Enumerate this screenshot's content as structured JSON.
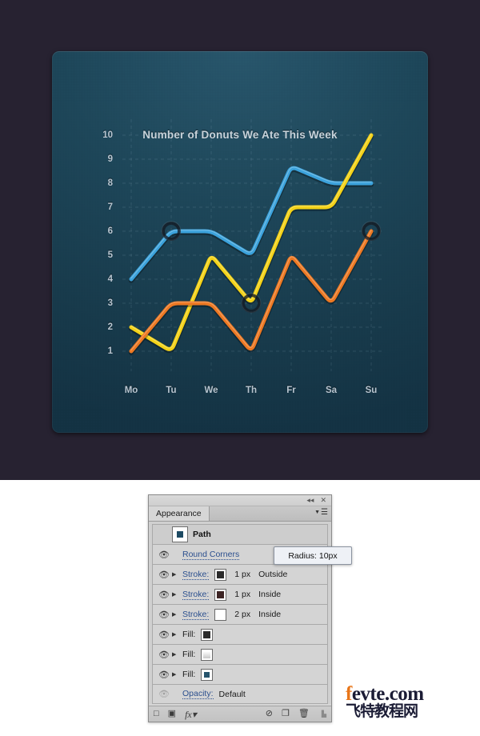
{
  "chart_data": {
    "type": "line",
    "title": "Number of Donuts We Ate This Week",
    "xlabel": "",
    "ylabel": "",
    "categories": [
      "Mo",
      "Tu",
      "We",
      "Th",
      "Fr",
      "Sa",
      "Su"
    ],
    "ylim": [
      1,
      10
    ],
    "yticks": [
      1,
      2,
      3,
      4,
      5,
      6,
      7,
      8,
      9,
      10
    ],
    "grid": true,
    "legend": "none",
    "series": [
      {
        "name": "blue",
        "color": "#3ba3dd",
        "values": [
          4,
          6,
          6,
          5,
          8.7,
          8,
          8
        ]
      },
      {
        "name": "yellow",
        "color": "#f5d316",
        "values": [
          2,
          1,
          5,
          3,
          7,
          7,
          10
        ]
      },
      {
        "name": "orange",
        "color": "#ee7821",
        "values": [
          1,
          3,
          3,
          1,
          5,
          3,
          6
        ]
      }
    ],
    "markers": [
      {
        "series": "blue",
        "category": "Tu",
        "value": 6
      },
      {
        "series": "yellow",
        "category": "Th",
        "value": 3
      },
      {
        "series": "orange",
        "category": "Su",
        "value": 6
      }
    ]
  },
  "panel": {
    "titlebar": {
      "collapse_icon": "collapse-double-arrow-icon",
      "close_icon": "close-icon"
    },
    "tab_label": "Appearance",
    "menu_icon": "panel-menu-icon",
    "rows": [
      {
        "type": "header",
        "label": "Path",
        "eye": false,
        "swatch": "#1d4a63"
      },
      {
        "type": "effect",
        "label": "Round Corners",
        "eye": true,
        "eye_dim": false,
        "disclosure": false
      },
      {
        "type": "stroke",
        "label": "Stroke:",
        "eye": true,
        "disclosure": true,
        "color": "#2b2b2b",
        "width": "1 px",
        "align": "Outside"
      },
      {
        "type": "stroke",
        "label": "Stroke:",
        "eye": true,
        "disclosure": true,
        "color": "#3d2424",
        "width": "1 px",
        "align": "Inside"
      },
      {
        "type": "stroke",
        "label": "Stroke:",
        "eye": true,
        "disclosure": true,
        "color": "#ffffff",
        "width": "2 px",
        "align": "Inside"
      },
      {
        "type": "fill",
        "label": "Fill:",
        "eye": true,
        "disclosure": true,
        "color": "#2b2b2b"
      },
      {
        "type": "fill",
        "label": "Fill:",
        "eye": true,
        "disclosure": true,
        "color": "gradient-white"
      },
      {
        "type": "fill",
        "label": "Fill:",
        "eye": true,
        "disclosure": true,
        "color": "#26546c"
      },
      {
        "type": "opacity",
        "label": "Opacity:",
        "value": "Default",
        "eye": true,
        "eye_dim": true
      }
    ],
    "tooltip": "Radius: 10px",
    "footer_icons": [
      "new-art-has-basic-appearance-icon",
      "clear-appearance-icon",
      "fx-icon",
      "no-appearance-icon",
      "duplicate-item-icon",
      "delete-item-icon",
      "resize-grip-icon"
    ]
  },
  "logo": {
    "f": "f",
    "rest": "evte.com",
    "chinese": "飞特教程网"
  }
}
